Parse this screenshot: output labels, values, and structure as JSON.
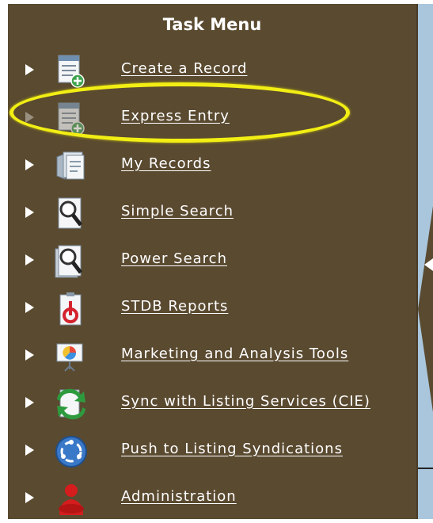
{
  "title": "Task Menu",
  "items": [
    {
      "label": "Create a Record",
      "icon": "create-record-icon"
    },
    {
      "label": "Express Entry",
      "icon": "express-entry-icon"
    },
    {
      "label": "My Records",
      "icon": "my-records-icon"
    },
    {
      "label": "Simple Search",
      "icon": "simple-search-icon"
    },
    {
      "label": "Power Search",
      "icon": "power-search-icon"
    },
    {
      "label": "STDB Reports",
      "icon": "reports-icon"
    },
    {
      "label": "Marketing and Analysis Tools",
      "icon": "marketing-tools-icon"
    },
    {
      "label": "Sync with Listing Services (CIE)",
      "icon": "sync-icon"
    },
    {
      "label": "Push to Listing Syndications",
      "icon": "globe-icon"
    },
    {
      "label": "Administration",
      "icon": "administration-icon"
    }
  ],
  "highlighted_item": "Express Entry",
  "colors": {
    "menu_background": "#5a4a30",
    "side_panel": "#a9c6dc",
    "highlight": "#f2ee14",
    "text": "#ffffff"
  }
}
